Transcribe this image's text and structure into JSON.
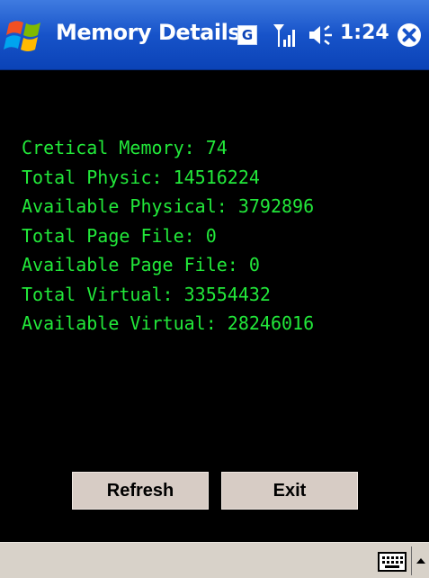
{
  "window": {
    "title": "Memory Details",
    "status_g": "G",
    "clock": "1:24",
    "accent_color": "#1753c9"
  },
  "icons": {
    "start": "windows-flag-icon",
    "signal": "signal-strength-icon",
    "volume": "speaker-volume-icon",
    "close": "close-icon",
    "keyboard": "keyboard-icon",
    "sip_arrow": "up-arrow-icon"
  },
  "memory": {
    "text_color": "#22e83a",
    "lines": [
      "Cretical Memory: 74",
      "Total Physic: 14516224",
      "Available Physical: 3792896",
      "Total Page File: 0",
      "Available Page File: 0",
      "Total Virtual: 33554432",
      "Available Virtual: 28246016"
    ]
  },
  "buttons": {
    "refresh": "Refresh",
    "exit": "Exit"
  }
}
